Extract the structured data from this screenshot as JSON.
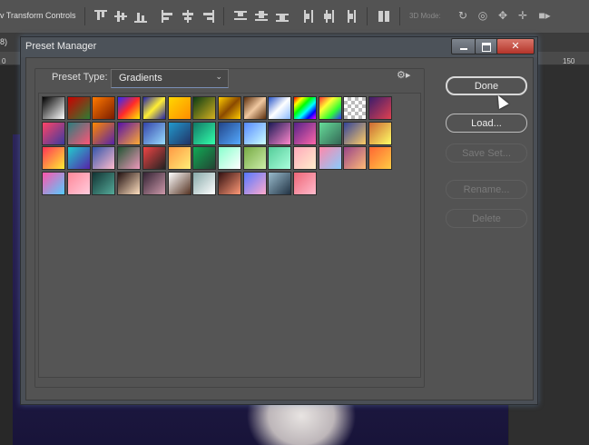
{
  "options_bar": {
    "transform_label": "v Transform Controls",
    "mode3d_label": "3D Mode:"
  },
  "doc_tab": {
    "text": "8) "
  },
  "ruler": {
    "tick_left": "0",
    "tick_right": "150"
  },
  "dialog": {
    "title": "Preset Manager",
    "preset_type_label": "Preset Type:",
    "preset_type_value": "Gradients",
    "buttons": {
      "done": "Done",
      "load": "Load...",
      "save_set": "Save Set...",
      "rename": "Rename...",
      "delete": "Delete"
    }
  },
  "gradients": [
    [
      "#000000",
      "#ffffff"
    ],
    [
      "#cc0000",
      "#2e7d32"
    ],
    [
      "#ff7a00",
      "#7a1b00"
    ],
    [
      "#2a2aff",
      "#ff2a2a",
      "#ffee00"
    ],
    [
      "#2222aa",
      "#ffee33",
      "#2222aa"
    ],
    [
      "#ffd700",
      "#ff8c00"
    ],
    [
      "#0a3b14",
      "#d4b020"
    ],
    [
      "#ffcc00",
      "#8b4a00",
      "#ffcc00"
    ],
    [
      "#5a2d0c",
      "#f0c8a0",
      "#5a2d0c"
    ],
    [
      "#2855c8",
      "#ffffff",
      "#88b8ff"
    ],
    [
      "#ff0000",
      "#ffff00",
      "#00ff00",
      "#00ffff",
      "#0000ff",
      "#ff00ff"
    ],
    [
      "#ff3333",
      "#ffff33",
      "#33ff33",
      "#3333ff"
    ],
    [
      "checker"
    ],
    [
      "#3b1d6b",
      "#e04050"
    ],
    [
      "#ff4466",
      "#3a3aa0"
    ],
    [
      "#2a7d7d",
      "#ff5577"
    ],
    [
      "#ff8800",
      "#5522aa"
    ],
    [
      "#5511aa",
      "#ffaa33"
    ],
    [
      "#3344aa",
      "#99ddff"
    ],
    [
      "#2299cc",
      "#223366"
    ],
    [
      "#117766",
      "#33ffaa"
    ],
    [
      "#224488",
      "#55aaff"
    ],
    [
      "#5588ff",
      "#ccffff"
    ],
    [
      "#1a1a55",
      "#ff88cc"
    ],
    [
      "#552288",
      "#ff66aa"
    ],
    [
      "#66dd99",
      "#336655"
    ],
    [
      "#334499",
      "#ffcc66"
    ],
    [
      "#cc6633",
      "#ffff66"
    ],
    [
      "#ff3355",
      "#ffee33"
    ],
    [
      "#22cccc",
      "#5522aa"
    ],
    [
      "#3355aa",
      "#ffbbcc"
    ],
    [
      "#225533",
      "#ee99bb"
    ],
    [
      "#ee4444",
      "#222222"
    ],
    [
      "#ff9944",
      "#ffee77"
    ],
    [
      "#11aa55",
      "#224433"
    ],
    [
      "#88ffcc",
      "#ffffff"
    ],
    [
      "#77aa44",
      "#cceeaa"
    ],
    [
      "#55cc99",
      "#aaffdd"
    ],
    [
      "#ffaabb",
      "#ffeecc"
    ],
    [
      "#ff88aa",
      "#88ccff"
    ],
    [
      "#994488",
      "#ffbb77"
    ],
    [
      "#ff6633",
      "#ffcc44"
    ],
    [
      "#ff55aa",
      "#55ccff"
    ],
    [
      "#ff8899",
      "#ffccdd"
    ],
    [
      "#113333",
      "#55aa99"
    ],
    [
      "#221111",
      "#ffe0c0"
    ],
    [
      "#332233",
      "#cc99aa"
    ],
    [
      "#ffffff",
      "#553322"
    ],
    [
      "#88aaaa",
      "#ffffff"
    ],
    [
      "#331111",
      "#ff9977"
    ],
    [
      "#5577ff",
      "#ffaacc"
    ],
    [
      "#99bbcc",
      "#223344"
    ],
    [
      "#ee6677",
      "#ffbbcc"
    ]
  ]
}
